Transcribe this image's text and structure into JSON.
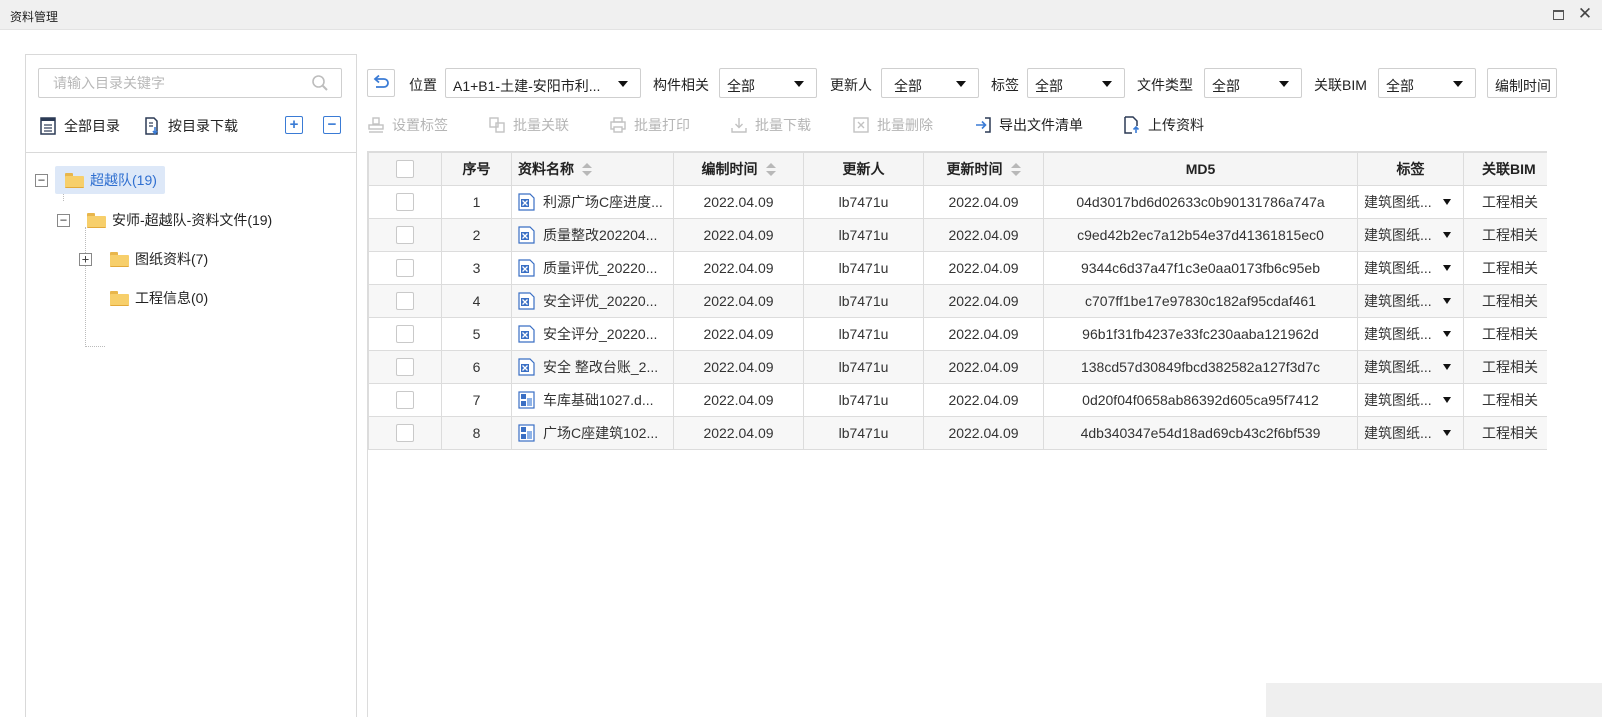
{
  "window": {
    "title": "资料管理"
  },
  "left": {
    "search_placeholder": "请输入目录关键字",
    "tools": {
      "all_dirs": "全部目录",
      "download_by_dir": "按目录下载"
    },
    "tree": [
      {
        "label": "超越队(19)",
        "level": 0,
        "expanded": true,
        "selected": true
      },
      {
        "label": "安师-超越队-资料文件(19)",
        "level": 1,
        "expanded": true
      },
      {
        "label": "图纸资料(7)",
        "level": 2,
        "expanded": false
      },
      {
        "label": "工程信息(0)",
        "level": 2,
        "leaf": true
      }
    ]
  },
  "filters": {
    "location_label": "位置",
    "location_value": "A1+B1-土建-安阳市利...",
    "component_label": "构件相关",
    "component_value": "全部",
    "updater_label": "更新人",
    "updater_value": "全部",
    "tag_label": "标签",
    "tag_value": "全部",
    "filetype_label": "文件类型",
    "filetype_value": "全部",
    "bim_label": "关联BIM",
    "bim_value": "全部",
    "edit_time_label": "编制时间"
  },
  "actions": {
    "set_tag": "设置标签",
    "batch_link": "批量关联",
    "batch_print": "批量打印",
    "batch_download": "批量下载",
    "batch_delete": "批量删除",
    "export_list": "导出文件清单",
    "upload": "上传资料"
  },
  "table": {
    "headers": {
      "seq": "序号",
      "name": "资料名称",
      "edit_time": "编制时间",
      "updater": "更新人",
      "update_time": "更新时间",
      "md5": "MD5",
      "tag": "标签",
      "bim": "关联BIM"
    },
    "rows": [
      {
        "seq": "1",
        "icon": "excel",
        "name": "利源广场C座进度...",
        "edit_time": "2022.04.09",
        "updater": "lb7471u",
        "update_time": "2022.04.09",
        "md5": "04d3017bd6d02633c0b90131786a747a",
        "tag": "建筑图纸...",
        "bim": "工程相关"
      },
      {
        "seq": "2",
        "icon": "excel",
        "name": "质量整改202204...",
        "edit_time": "2022.04.09",
        "updater": "lb7471u",
        "update_time": "2022.04.09",
        "md5": "c9ed42b2ec7a12b54e37d41361815ec0",
        "tag": "建筑图纸...",
        "bim": "工程相关"
      },
      {
        "seq": "3",
        "icon": "excel",
        "name": "质量评优_20220...",
        "edit_time": "2022.04.09",
        "updater": "lb7471u",
        "update_time": "2022.04.09",
        "md5": "9344c6d37a47f1c3e0aa0173fb6c95eb",
        "tag": "建筑图纸...",
        "bim": "工程相关"
      },
      {
        "seq": "4",
        "icon": "excel",
        "name": "安全评优_20220...",
        "edit_time": "2022.04.09",
        "updater": "lb7471u",
        "update_time": "2022.04.09",
        "md5": "c707ff1be17e97830c182af95cdaf461",
        "tag": "建筑图纸...",
        "bim": "工程相关"
      },
      {
        "seq": "5",
        "icon": "excel",
        "name": "安全评分_20220...",
        "edit_time": "2022.04.09",
        "updater": "lb7471u",
        "update_time": "2022.04.09",
        "md5": "96b1f31fb4237e33fc230aaba121962d",
        "tag": "建筑图纸...",
        "bim": "工程相关"
      },
      {
        "seq": "6",
        "icon": "excel",
        "name": "安全 整改台账_2...",
        "edit_time": "2022.04.09",
        "updater": "lb7471u",
        "update_time": "2022.04.09",
        "md5": "138cd57d30849fbcd382582a127f3d7c",
        "tag": "建筑图纸...",
        "bim": "工程相关"
      },
      {
        "seq": "7",
        "icon": "drawing",
        "name": "车库基础1027.d...",
        "edit_time": "2022.04.09",
        "updater": "lb7471u",
        "update_time": "2022.04.09",
        "md5": "0d20f04f0658ab86392d605ca95f7412",
        "tag": "建筑图纸...",
        "bim": "工程相关"
      },
      {
        "seq": "8",
        "icon": "drawing",
        "name": "广场C座建筑102...",
        "edit_time": "2022.04.09",
        "updater": "lb7471u",
        "update_time": "2022.04.09",
        "md5": "4db340347e54d18ad69cb43c2f6bf539",
        "tag": "建筑图纸...",
        "bim": "工程相关"
      }
    ]
  },
  "colors": {
    "accent": "#3a7bd5",
    "selected_bg": "#dde8f8",
    "folder": "#f7cf6b",
    "disabled_text": "#b5b5b5"
  }
}
